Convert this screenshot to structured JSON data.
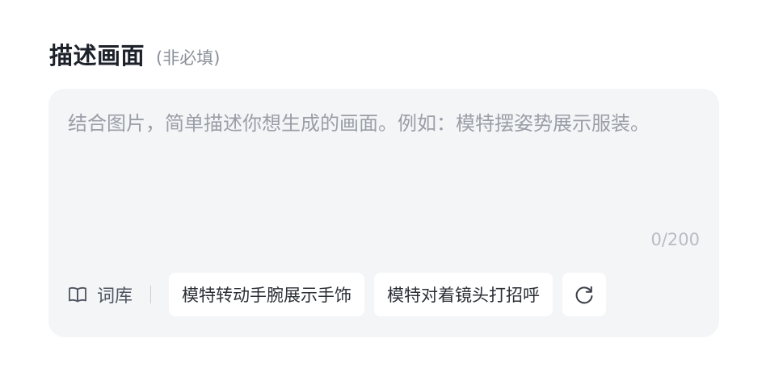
{
  "header": {
    "title": "描述画面",
    "subtitle": "(非必填)"
  },
  "prompt": {
    "value": "",
    "placeholder": "结合图片，简单描述你想生成的画面。例如：模特摆姿势展示服装。",
    "counter": "0/200"
  },
  "toolbar": {
    "lexicon_icon": "book-icon",
    "lexicon_label": "词库",
    "suggestions": [
      "模特转动手腕展示手饰",
      "模特对着镜头打招呼"
    ],
    "refresh_icon": "refresh-icon"
  },
  "colors": {
    "card_background": "#f4f5f7",
    "chip_background": "#ffffff",
    "placeholder_text": "#9a9ea7"
  }
}
